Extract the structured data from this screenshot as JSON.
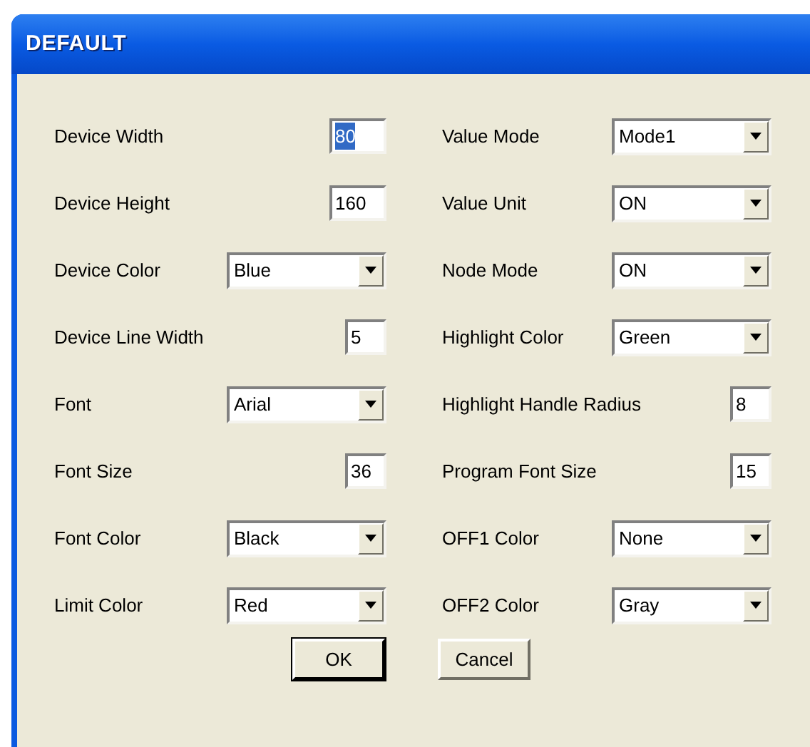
{
  "window": {
    "title": "DEFAULT"
  },
  "columns": [
    [
      {
        "label": "Device Width",
        "kind": "text",
        "value": "80",
        "highlighted": true
      },
      {
        "label": "Device Height",
        "kind": "text",
        "value": "160",
        "highlighted": false
      },
      {
        "label": "Device Color",
        "kind": "dropdown",
        "value": "Blue"
      },
      {
        "label": "Device Line Width",
        "kind": "text",
        "value": "5",
        "highlighted": false
      },
      {
        "label": "Font",
        "kind": "dropdown",
        "value": "Arial"
      },
      {
        "label": "Font Size",
        "kind": "text",
        "value": "36",
        "highlighted": false
      },
      {
        "label": "Font Color",
        "kind": "dropdown",
        "value": "Black"
      },
      {
        "label": "Limit Color",
        "kind": "dropdown",
        "value": "Red"
      }
    ],
    [
      {
        "label": "Value Mode",
        "kind": "dropdown",
        "value": "Mode1"
      },
      {
        "label": "Value Unit",
        "kind": "dropdown",
        "value": "ON"
      },
      {
        "label": "Node Mode",
        "kind": "dropdown",
        "value": "ON"
      },
      {
        "label": "Highlight Color",
        "kind": "dropdown",
        "value": "Green"
      },
      {
        "label": "Highlight Handle Radius",
        "kind": "text",
        "value": "8",
        "highlighted": false
      },
      {
        "label": "Program Font Size",
        "kind": "text",
        "value": "15",
        "highlighted": false
      },
      {
        "label": "OFF1 Color",
        "kind": "dropdown",
        "value": "None"
      },
      {
        "label": "OFF2 Color",
        "kind": "dropdown",
        "value": "Gray"
      }
    ]
  ],
  "buttons": [
    {
      "label": "OK",
      "default": true
    },
    {
      "label": "Cancel",
      "default": false
    }
  ]
}
